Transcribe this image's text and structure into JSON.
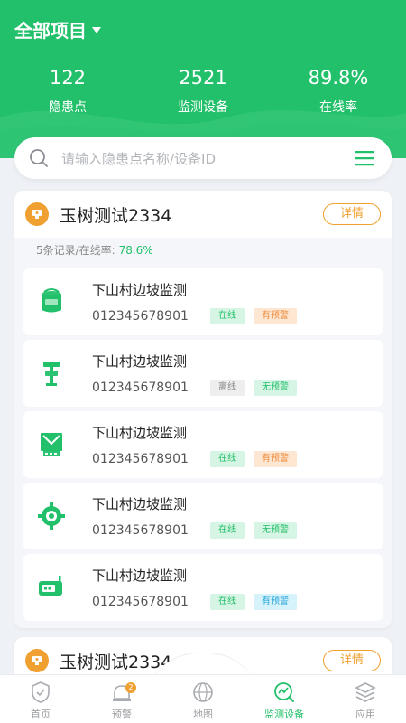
{
  "header": {
    "title": "全部项目",
    "stats": [
      {
        "value": "122",
        "label": "隐患点"
      },
      {
        "value": "2521",
        "label": "监测设备"
      },
      {
        "value": "89.8%",
        "label": "在线率"
      }
    ]
  },
  "search": {
    "placeholder": "请输入隐患点名称/设备ID"
  },
  "projects": [
    {
      "name": "玉树测试2334",
      "detail_label": "详情",
      "summary_prefix": "5条记录/在线率:",
      "summary_rate": "78.6%",
      "devices": [
        {
          "name": "下山村边坡监测",
          "id": "012345678901",
          "status": "在线",
          "warning": "有预警",
          "icon": "bucket-sensor-icon"
        },
        {
          "name": "下山村边坡监测",
          "id": "012345678901",
          "status": "离线",
          "warning": "无预警",
          "icon": "pole-sensor-icon"
        },
        {
          "name": "下山村边坡监测",
          "id": "012345678901",
          "status": "在线",
          "warning": "有预警",
          "icon": "gateway-sensor-icon"
        },
        {
          "name": "下山村边坡监测",
          "id": "012345678901",
          "status": "在线",
          "warning": "无预警",
          "icon": "gear-sensor-icon"
        },
        {
          "name": "下山村边坡监测",
          "id": "012345678901",
          "status": "在线",
          "warning": "有预警",
          "icon": "dtu-device-icon"
        }
      ]
    },
    {
      "name": "玉树测试2334",
      "detail_label": "详情"
    }
  ],
  "nav": {
    "items": [
      {
        "label": "首页",
        "icon": "home-shield-icon"
      },
      {
        "label": "预警",
        "icon": "alarm-icon",
        "badge": "2"
      },
      {
        "label": "地图",
        "icon": "globe-icon"
      },
      {
        "label": "监测设备",
        "icon": "monitor-device-icon",
        "active": true
      },
      {
        "label": "应用",
        "icon": "layers-icon"
      }
    ]
  },
  "colors": {
    "primary": "#22c06a",
    "accent": "#f0a030"
  }
}
